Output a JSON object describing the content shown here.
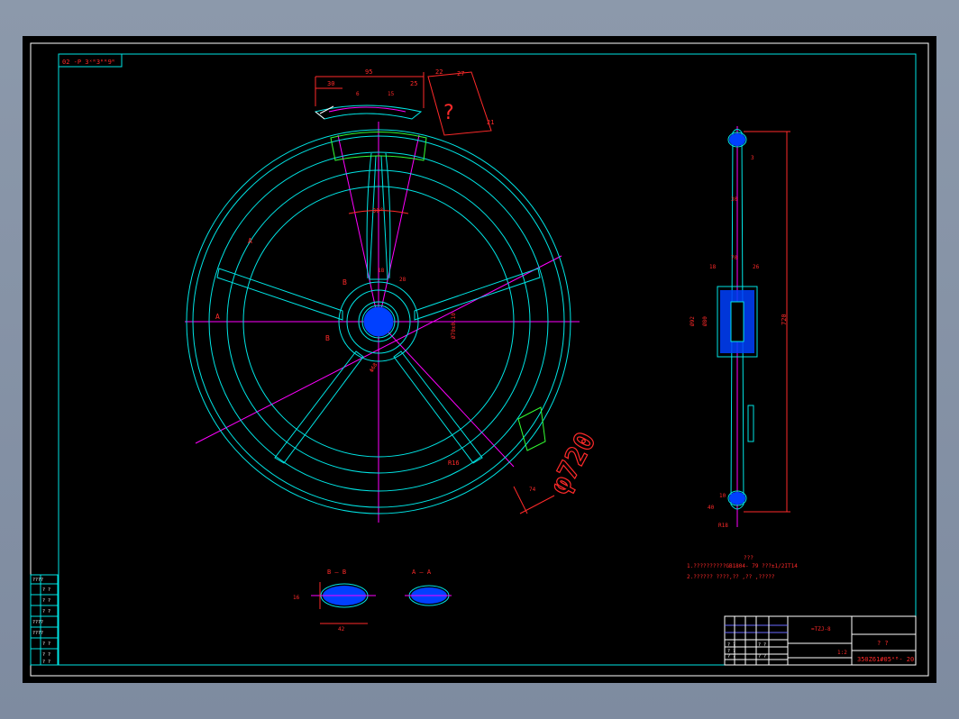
{
  "drawing": {
    "stamp_text": "02 -P 3ˣᴿ3ᴿᴿ9ᴿ",
    "big_label": "φ720",
    "section_b_label": "B — B",
    "section_a_label": "A — A",
    "notes_title": "???",
    "note_line_1": "1.??????????GB1804- 79      ???±1/2IT14",
    "note_line_2": "2.?????? ????,?? ,?? ,?????",
    "title_code": "=TZJ-8",
    "title_name": "? ?",
    "part_code": "350Z61#05ᴬᴮ- 20",
    "scale_ratio": "1:2"
  },
  "dims": {
    "top_95": "95",
    "top_30": "30",
    "top_25": "25",
    "top_22": "22",
    "top_27": "27",
    "top_6": "6",
    "top_15": "15",
    "top_21": "21",
    "question": "?",
    "angle_30": "30°",
    "spoke_18": "18",
    "spoke_28": "28",
    "r16": "R16",
    "hub_68": "Φ68",
    "hub_70": "Ø70±0.10",
    "hub_86": "Ø86",
    "side_720": "720",
    "side_10": "10",
    "side_18": "18",
    "side_70": "70",
    "side_26": "26",
    "side_80": "Ø80",
    "side_92": "Ø92",
    "side_30": "30",
    "side_40": "40",
    "side_r18": "R18",
    "side_3": "3",
    "sec_16": "16",
    "sec_42": "42",
    "lbl_a": "A",
    "lbl_b": "B",
    "small_74": "74"
  },
  "left_panel": [
    "????",
    "? ?",
    "? ?",
    "? ?",
    "????",
    "????",
    "? ?",
    "? ?",
    "? ?"
  ],
  "title_block_rows": [
    "? ?",
    "? ?",
    "? ?",
    "? ?",
    "? ?"
  ]
}
